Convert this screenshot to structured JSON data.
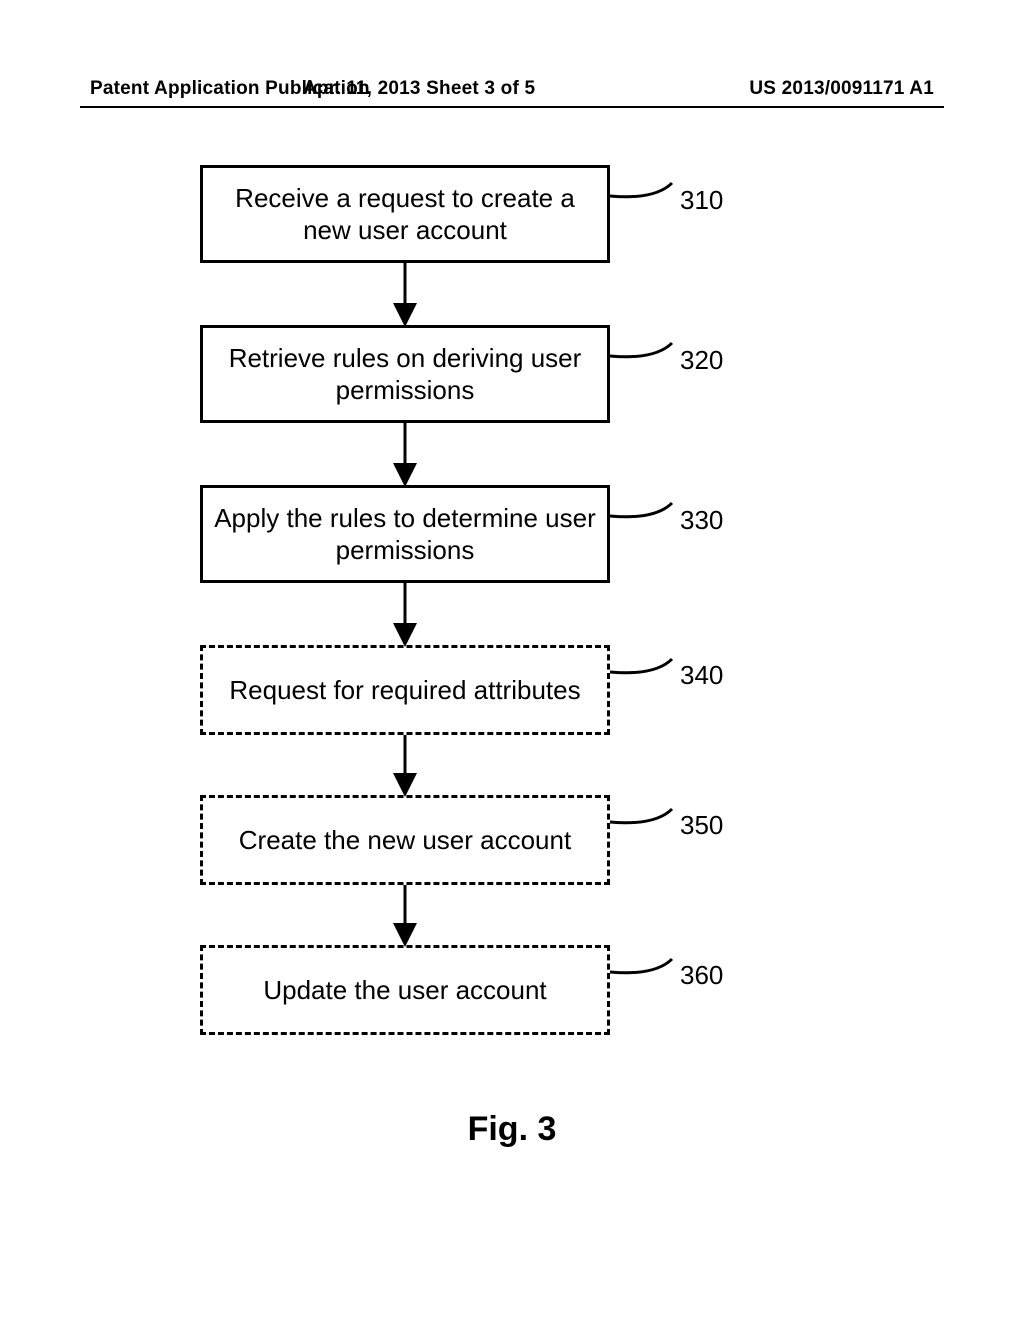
{
  "header": {
    "left": "Patent Application Publication",
    "center": "Apr. 11, 2013  Sheet 3 of 5",
    "right": "US 2013/0091171 A1"
  },
  "steps": [
    {
      "ref": "310",
      "text": "Receive a request to create a new user account",
      "dashed": false
    },
    {
      "ref": "320",
      "text": "Retrieve rules on deriving user permissions",
      "dashed": false
    },
    {
      "ref": "330",
      "text": "Apply the rules to determine user permissions",
      "dashed": false
    },
    {
      "ref": "340",
      "text": "Request for required attributes",
      "dashed": true
    },
    {
      "ref": "350",
      "text": "Create the new user account",
      "dashed": true
    },
    {
      "ref": "360",
      "text": "Update the user account",
      "dashed": true
    }
  ],
  "figure_caption": "Fig. 3"
}
